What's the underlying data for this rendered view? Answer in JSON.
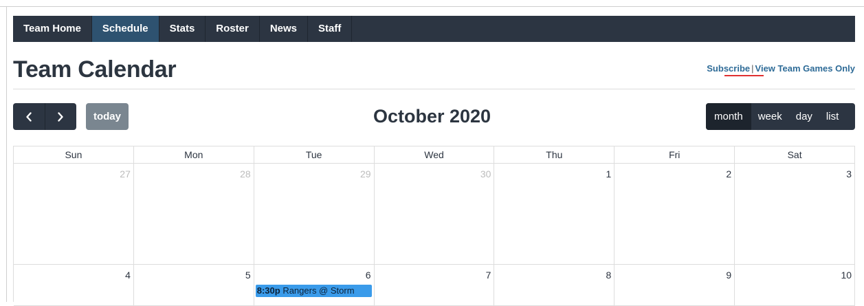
{
  "nav": {
    "items": [
      {
        "label": "Team Home",
        "active": false
      },
      {
        "label": "Schedule",
        "active": true
      },
      {
        "label": "Stats",
        "active": false
      },
      {
        "label": "Roster",
        "active": false
      },
      {
        "label": "News",
        "active": false
      },
      {
        "label": "Staff",
        "active": false
      }
    ]
  },
  "header": {
    "title": "Team Calendar",
    "subscribe_label": "Subscribe",
    "separator": "|",
    "games_only_label": "View Team Games Only"
  },
  "toolbar": {
    "prev_icon": "chevron-left-icon",
    "next_icon": "chevron-right-icon",
    "today_label": "today",
    "month_title": "October 2020",
    "views": [
      {
        "label": "month",
        "active": true
      },
      {
        "label": "week",
        "active": false
      },
      {
        "label": "day",
        "active": false
      },
      {
        "label": "list",
        "active": false
      }
    ]
  },
  "calendar": {
    "days_of_week": [
      "Sun",
      "Mon",
      "Tue",
      "Wed",
      "Thu",
      "Fri",
      "Sat"
    ],
    "weeks": [
      [
        {
          "num": "27",
          "other": true
        },
        {
          "num": "28",
          "other": true
        },
        {
          "num": "29",
          "other": true
        },
        {
          "num": "30",
          "other": true
        },
        {
          "num": "1",
          "other": false
        },
        {
          "num": "2",
          "other": false
        },
        {
          "num": "3",
          "other": false
        }
      ],
      [
        {
          "num": "4",
          "other": false
        },
        {
          "num": "5",
          "other": false
        },
        {
          "num": "6",
          "other": false,
          "event": {
            "time": "8:30p",
            "title": "Rangers @ Storm"
          }
        },
        {
          "num": "7",
          "other": false
        },
        {
          "num": "8",
          "other": false
        },
        {
          "num": "9",
          "other": false
        },
        {
          "num": "10",
          "other": false
        }
      ]
    ]
  },
  "colors": {
    "navbar": "#2c3542",
    "nav_active": "#2e5270",
    "today_button": "#7a8690",
    "event": "#3a9bea",
    "link": "#2e6b97",
    "subscribe_underline": "#e03030"
  }
}
